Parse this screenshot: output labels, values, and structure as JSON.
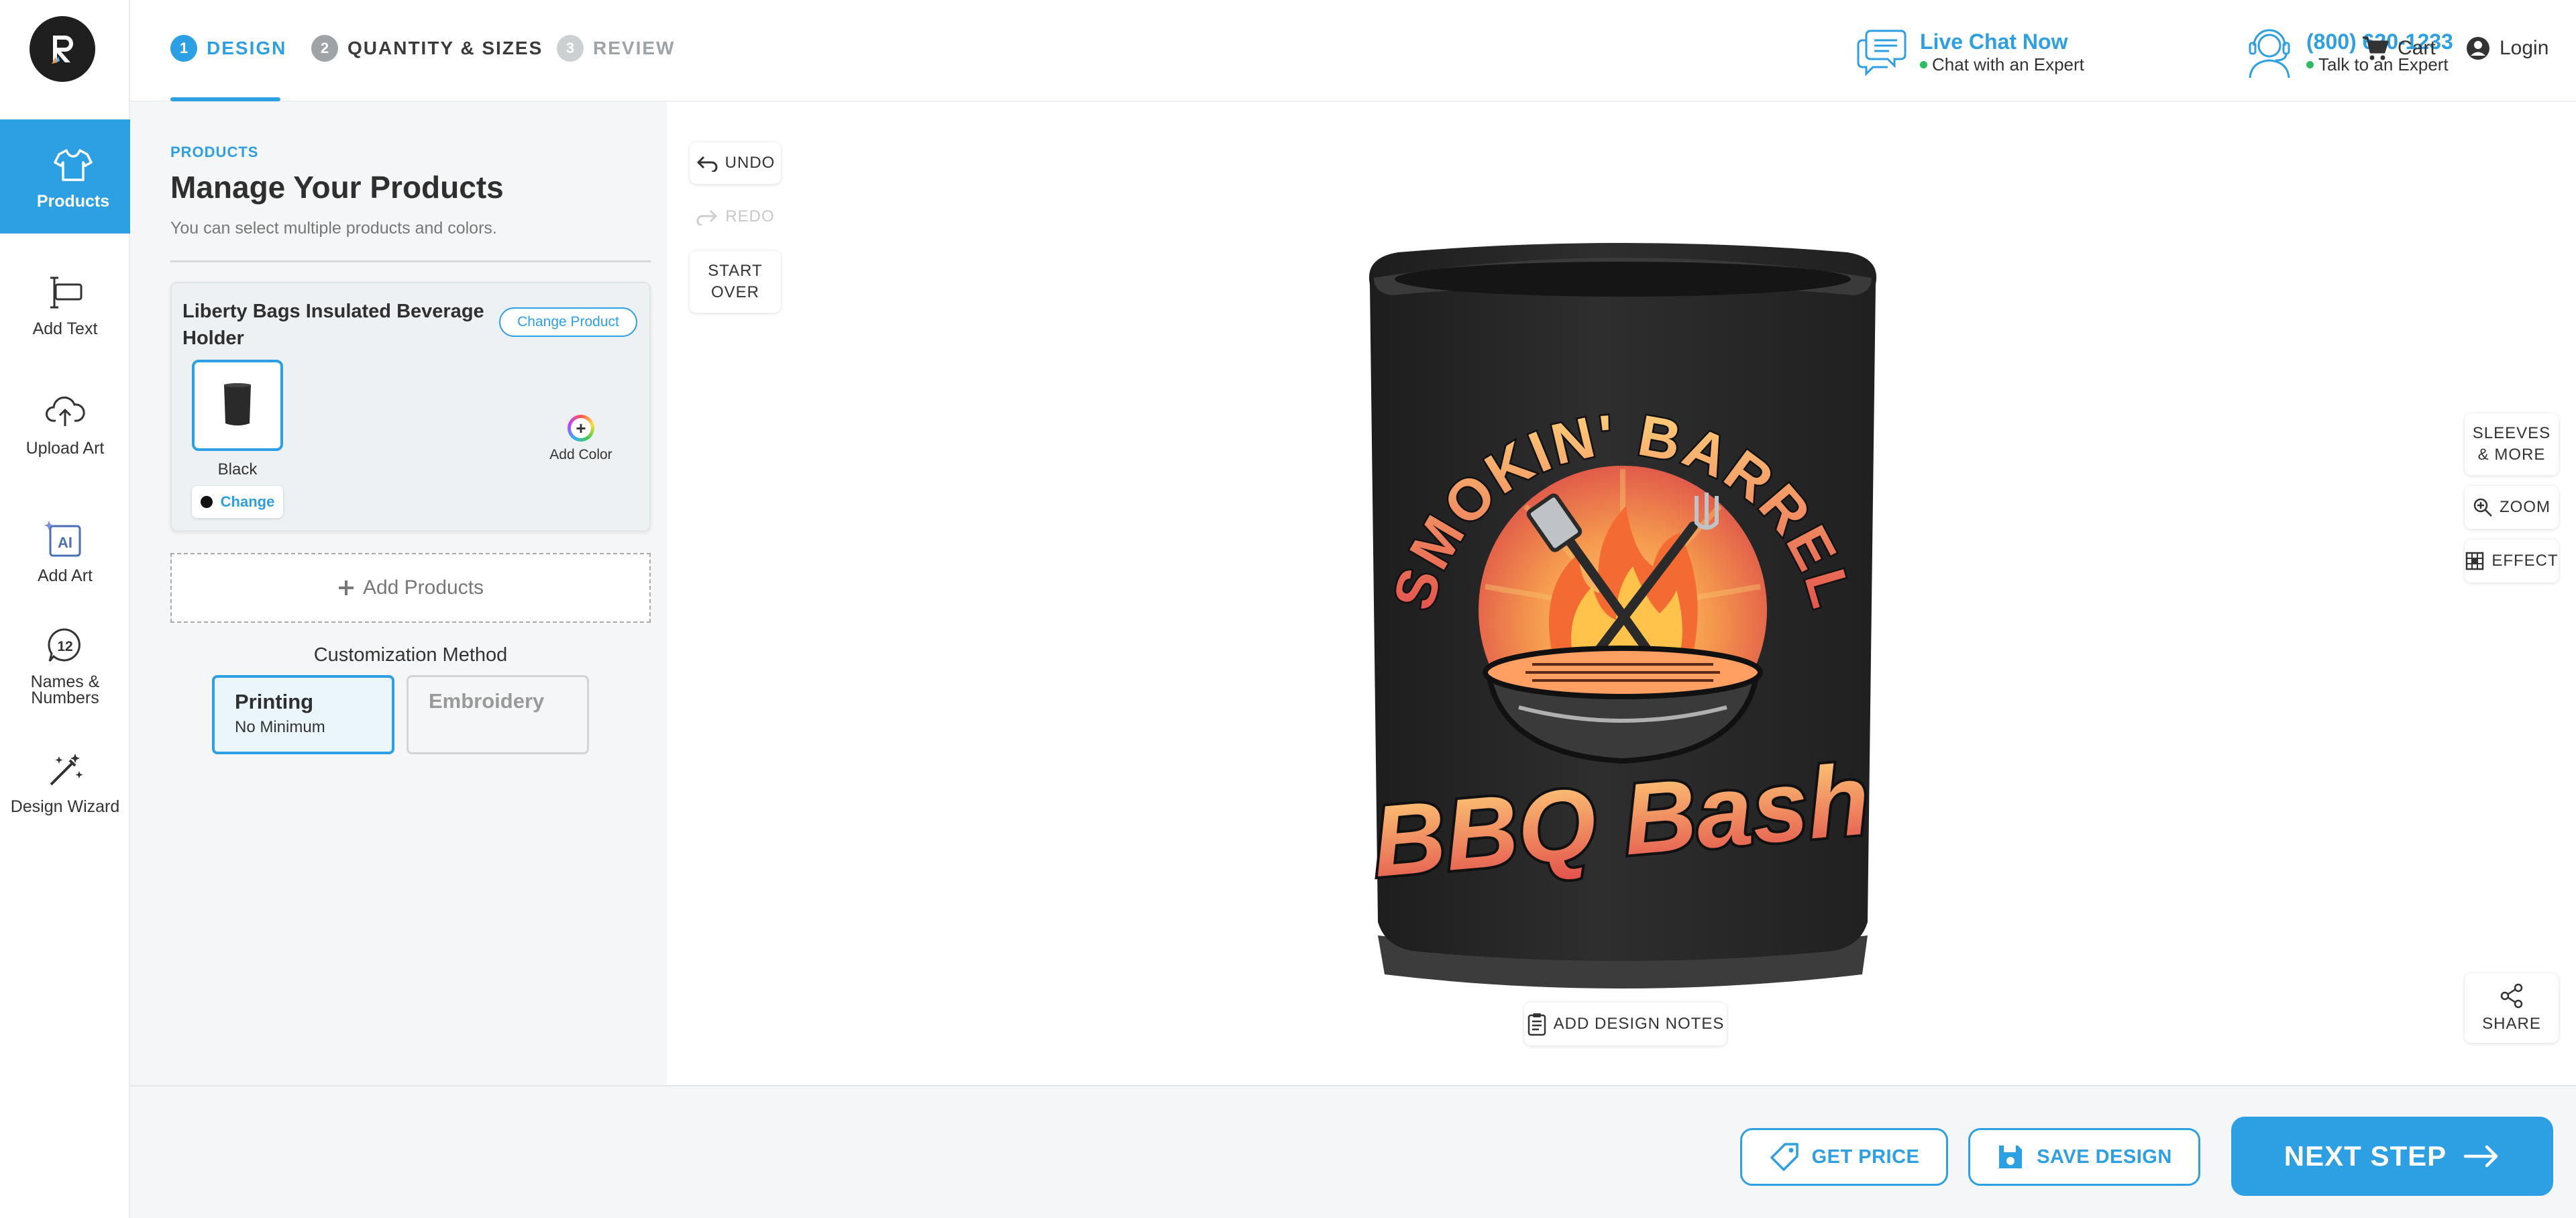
{
  "steps": [
    {
      "num": "1",
      "label": "DESIGN"
    },
    {
      "num": "2",
      "label": "QUANTITY & SIZES"
    },
    {
      "num": "3",
      "label": "REVIEW"
    }
  ],
  "header": {
    "live_chat": {
      "title": "Live Chat Now",
      "sub": "Chat with an Expert"
    },
    "phone": {
      "title": "(800) 620-1233",
      "sub": "Talk to an Expert"
    },
    "cart": "Cart",
    "login": "Login"
  },
  "sidebar": {
    "items": [
      {
        "label": "Products",
        "icon": "tshirt-icon"
      },
      {
        "label": "Add Text",
        "icon": "text-cursor-icon"
      },
      {
        "label": "Upload Art",
        "icon": "cloud-upload-icon"
      },
      {
        "label": "Add Art",
        "icon": "ai-art-icon"
      },
      {
        "label": "Names & Numbers",
        "icon": "numbers-badge-icon"
      },
      {
        "label": "Design Wizard",
        "icon": "magic-wand-icon"
      }
    ],
    "badge_number": "12",
    "ai_text": "AI"
  },
  "panel": {
    "kicker": "PRODUCTS",
    "title": "Manage Your Products",
    "subtitle": "You can select multiple products and colors.",
    "product_name": "Liberty Bags Insulated Beverage Holder",
    "change_product": "Change Product",
    "color_label": "Black",
    "change_color": "Change",
    "add_color": "Add Color",
    "add_products": "Add Products",
    "customization_label": "Customization Method",
    "methods": [
      {
        "name": "Printing",
        "sub": "No Minimum"
      },
      {
        "name": "Embroidery",
        "sub": ""
      }
    ]
  },
  "canvas": {
    "undo": "UNDO",
    "redo": "REDO",
    "start_over": "START OVER",
    "sleeves": "SLEEVES & MORE",
    "zoom": "ZOOM",
    "effect": "EFFECT",
    "share": "SHARE",
    "design_notes": "ADD DESIGN NOTES",
    "design_line1": "SMOKIN' BARREL",
    "design_line2": "BBQ Bash"
  },
  "footer": {
    "get_price": "GET PRICE",
    "save_design": "SAVE DESIGN",
    "next_step": "NEXT STEP"
  },
  "colors": {
    "accent": "#2d9fe3",
    "status_green": "#2dbd5e",
    "product": "#2a2a2a"
  }
}
